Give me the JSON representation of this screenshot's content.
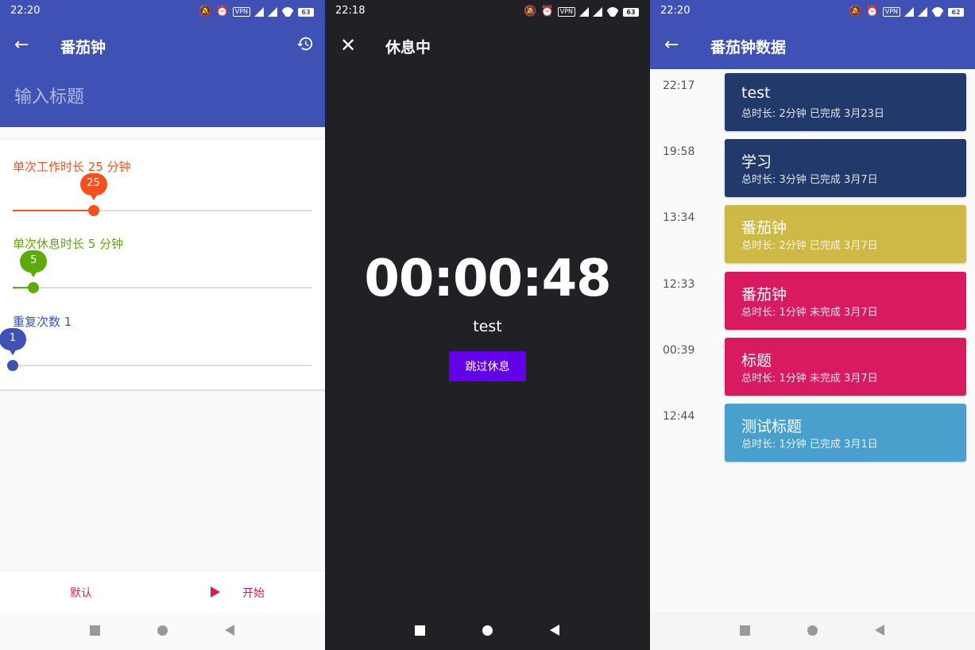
{
  "screen1": {
    "status_time": "22:20",
    "battery": "63",
    "title": "番茄钟",
    "title_placeholder": "输入标题",
    "work": {
      "label": "单次工作时长 25 分钟",
      "value": "25",
      "fraction": 0.27,
      "color": "#f4511e"
    },
    "rest": {
      "label": "单次休息时长 5 分钟",
      "value": "5",
      "fraction": 0.07,
      "color": "#5daa0a"
    },
    "repeat": {
      "label": "重复次数 1",
      "value": "1",
      "fraction": 0.0,
      "color": "#3f51b5"
    },
    "default_button": "默认",
    "start_button": "开始",
    "colors": {
      "primary": "#3f51b5",
      "accent": "#d81b60"
    }
  },
  "screen2": {
    "status_time": "22:18",
    "battery": "63",
    "title": "休息中",
    "timer": "00:00:48",
    "subtitle": "test",
    "skip_button": "跳过休息",
    "colors": {
      "background": "#202124",
      "button": "#6200ea"
    }
  },
  "screen3": {
    "status_time": "22:20",
    "battery": "62",
    "title": "番茄钟数据",
    "records": [
      {
        "time": "22:17",
        "title": "test",
        "meta": "总时长: 2分钟   已完成   3月23日",
        "color": "#223a6b"
      },
      {
        "time": "19:58",
        "title": "学习",
        "meta": "总时长: 3分钟   已完成   3月7日",
        "color": "#223a6b"
      },
      {
        "time": "13:34",
        "title": "番茄钟",
        "meta": "总时长: 2分钟   已完成   3月7日",
        "color": "#cfb946"
      },
      {
        "time": "12:33",
        "title": "番茄钟",
        "meta": "总时长: 1分钟   未完成   3月7日",
        "color": "#d81b60"
      },
      {
        "time": "00:39",
        "title": "标题",
        "meta": "总时长: 1分钟   未完成   3月7日",
        "color": "#d81b60"
      },
      {
        "time": "12:44",
        "title": "测试标题",
        "meta": "总时长: 1分钟   已完成   3月1日",
        "color": "#4aa0cc"
      }
    ]
  }
}
